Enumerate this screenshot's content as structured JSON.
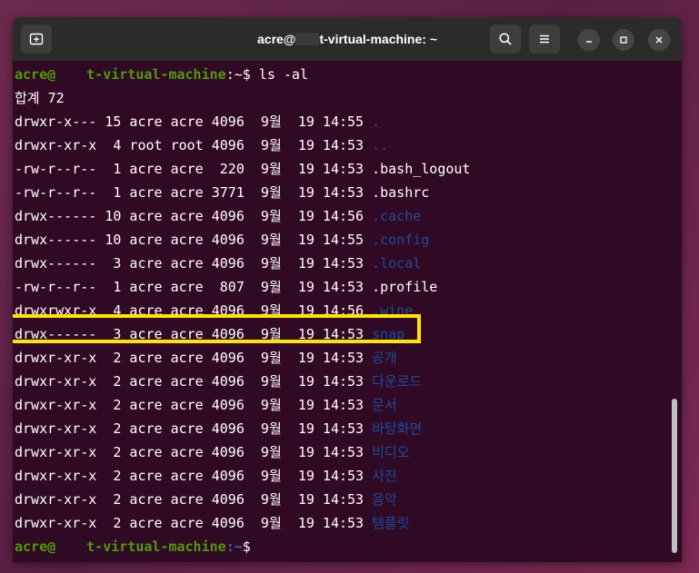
{
  "window": {
    "title_prefix": "acre@",
    "title_suffix": "t-virtual-machine: ~"
  },
  "terminal": {
    "prompt1": {
      "user": "acre@",
      "host_suffix": "t-virtual-machine",
      "path": ":~",
      "sign": "$",
      "command": " ls -al"
    },
    "total_line": "합계 72",
    "rows": [
      {
        "info": "drwxr-x--- 15 acre acre 4096  9월  19 14:55 ",
        "name": ".",
        "type": "dir"
      },
      {
        "info": "drwxr-xr-x  4 root root 4096  9월  19 14:53 ",
        "name": "..",
        "type": "dir"
      },
      {
        "info": "-rw-r--r--  1 acre acre  220  9월  19 14:53 ",
        "name": ".bash_logout",
        "type": "file"
      },
      {
        "info": "-rw-r--r--  1 acre acre 3771  9월  19 14:53 ",
        "name": ".bashrc",
        "type": "file"
      },
      {
        "info": "drwx------ 10 acre acre 4096  9월  19 14:56 ",
        "name": ".cache",
        "type": "dir"
      },
      {
        "info": "drwx------ 10 acre acre 4096  9월  19 14:55 ",
        "name": ".config",
        "type": "dir"
      },
      {
        "info": "drwx------  3 acre acre 4096  9월  19 14:53 ",
        "name": ".local",
        "type": "dir"
      },
      {
        "info": "-rw-r--r--  1 acre acre  807  9월  19 14:53 ",
        "name": ".profile",
        "type": "file"
      },
      {
        "info": "drwxrwxr-x  4 acre acre 4096  9월  19 14:56 ",
        "name": ".wine",
        "type": "dir"
      },
      {
        "info": "drwx------  3 acre acre 4096  9월  19 14:53 ",
        "name": "snap",
        "type": "dir"
      },
      {
        "info": "drwxr-xr-x  2 acre acre 4096  9월  19 14:53 ",
        "name": "공개",
        "type": "dir"
      },
      {
        "info": "drwxr-xr-x  2 acre acre 4096  9월  19 14:53 ",
        "name": "다운로드",
        "type": "dir"
      },
      {
        "info": "drwxr-xr-x  2 acre acre 4096  9월  19 14:53 ",
        "name": "문서",
        "type": "dir"
      },
      {
        "info": "drwxr-xr-x  2 acre acre 4096  9월  19 14:53 ",
        "name": "바탕화면",
        "type": "dir"
      },
      {
        "info": "drwxr-xr-x  2 acre acre 4096  9월  19 14:53 ",
        "name": "비디오",
        "type": "dir"
      },
      {
        "info": "drwxr-xr-x  2 acre acre 4096  9월  19 14:53 ",
        "name": "사진",
        "type": "dir"
      },
      {
        "info": "drwxr-xr-x  2 acre acre 4096  9월  19 14:53 ",
        "name": "음악",
        "type": "dir"
      },
      {
        "info": "drwxr-xr-x  2 acre acre 4096  9월  19 14:53 ",
        "name": "템플릿",
        "type": "dir"
      }
    ],
    "prompt2": {
      "user": "acre@",
      "host_suffix": "t-virtual-machine",
      "path": ":~",
      "sign": "$"
    }
  },
  "colors": {
    "terminal_bg": "#300a24",
    "prompt_user": "#4e9a06",
    "prompt_path": "#3465a4",
    "directory": "#1e4a9c",
    "highlight": "#ffe400"
  },
  "icons": {
    "new_tab": "new-tab-icon",
    "search": "search-icon",
    "menu": "hamburger-menu-icon",
    "minimize": "minimize-icon",
    "maximize": "maximize-icon",
    "close": "close-icon"
  }
}
